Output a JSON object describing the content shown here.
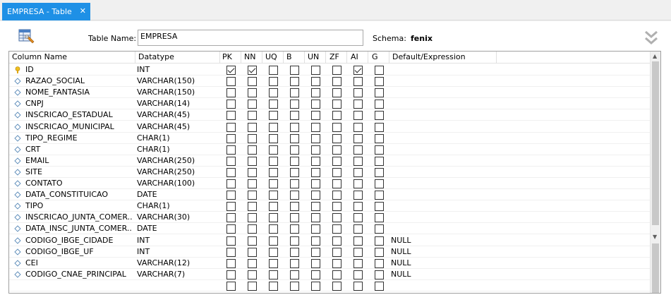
{
  "tab": {
    "label": "EMPRESA - Table",
    "close": "✕",
    "active_color": "#1e90e6"
  },
  "header": {
    "table_name_label": "Table Name:",
    "table_name_value": "EMPRESA",
    "schema_label": "Schema:",
    "schema_value": "fenix"
  },
  "columns_header": [
    "Column Name",
    "Datatype",
    "PK",
    "NN",
    "UQ",
    "B",
    "UN",
    "ZF",
    "AI",
    "G",
    "Default/Expression"
  ],
  "rows": [
    {
      "name": "ID",
      "type": "INT",
      "pk": true,
      "nn": true,
      "uq": false,
      "b": false,
      "un": false,
      "zf": false,
      "ai": true,
      "g": false,
      "def": "",
      "icon": "key-icon"
    },
    {
      "name": "RAZAO_SOCIAL",
      "type": "VARCHAR(150)",
      "pk": false,
      "nn": false,
      "uq": false,
      "b": false,
      "un": false,
      "zf": false,
      "ai": false,
      "g": false,
      "def": "",
      "icon": "diamond-icon"
    },
    {
      "name": "NOME_FANTASIA",
      "type": "VARCHAR(150)",
      "pk": false,
      "nn": false,
      "uq": false,
      "b": false,
      "un": false,
      "zf": false,
      "ai": false,
      "g": false,
      "def": "",
      "icon": "diamond-icon"
    },
    {
      "name": "CNPJ",
      "type": "VARCHAR(14)",
      "pk": false,
      "nn": false,
      "uq": false,
      "b": false,
      "un": false,
      "zf": false,
      "ai": false,
      "g": false,
      "def": "",
      "icon": "diamond-icon"
    },
    {
      "name": "INSCRICAO_ESTADUAL",
      "type": "VARCHAR(45)",
      "pk": false,
      "nn": false,
      "uq": false,
      "b": false,
      "un": false,
      "zf": false,
      "ai": false,
      "g": false,
      "def": "",
      "icon": "diamond-icon"
    },
    {
      "name": "INSCRICAO_MUNICIPAL",
      "type": "VARCHAR(45)",
      "pk": false,
      "nn": false,
      "uq": false,
      "b": false,
      "un": false,
      "zf": false,
      "ai": false,
      "g": false,
      "def": "",
      "icon": "diamond-icon"
    },
    {
      "name": "TIPO_REGIME",
      "type": "CHAR(1)",
      "pk": false,
      "nn": false,
      "uq": false,
      "b": false,
      "un": false,
      "zf": false,
      "ai": false,
      "g": false,
      "def": "",
      "icon": "diamond-icon"
    },
    {
      "name": "CRT",
      "type": "CHAR(1)",
      "pk": false,
      "nn": false,
      "uq": false,
      "b": false,
      "un": false,
      "zf": false,
      "ai": false,
      "g": false,
      "def": "",
      "icon": "diamond-icon"
    },
    {
      "name": "EMAIL",
      "type": "VARCHAR(250)",
      "pk": false,
      "nn": false,
      "uq": false,
      "b": false,
      "un": false,
      "zf": false,
      "ai": false,
      "g": false,
      "def": "",
      "icon": "diamond-icon"
    },
    {
      "name": "SITE",
      "type": "VARCHAR(250)",
      "pk": false,
      "nn": false,
      "uq": false,
      "b": false,
      "un": false,
      "zf": false,
      "ai": false,
      "g": false,
      "def": "",
      "icon": "diamond-icon"
    },
    {
      "name": "CONTATO",
      "type": "VARCHAR(100)",
      "pk": false,
      "nn": false,
      "uq": false,
      "b": false,
      "un": false,
      "zf": false,
      "ai": false,
      "g": false,
      "def": "",
      "icon": "diamond-icon"
    },
    {
      "name": "DATA_CONSTITUICAO",
      "type": "DATE",
      "pk": false,
      "nn": false,
      "uq": false,
      "b": false,
      "un": false,
      "zf": false,
      "ai": false,
      "g": false,
      "def": "",
      "icon": "diamond-icon"
    },
    {
      "name": "TIPO",
      "type": "CHAR(1)",
      "pk": false,
      "nn": false,
      "uq": false,
      "b": false,
      "un": false,
      "zf": false,
      "ai": false,
      "g": false,
      "def": "",
      "icon": "diamond-icon"
    },
    {
      "name": "INSCRICAO_JUNTA_COMER...",
      "type": "VARCHAR(30)",
      "pk": false,
      "nn": false,
      "uq": false,
      "b": false,
      "un": false,
      "zf": false,
      "ai": false,
      "g": false,
      "def": "",
      "icon": "diamond-icon"
    },
    {
      "name": "DATA_INSC_JUNTA_COMER...",
      "type": "DATE",
      "pk": false,
      "nn": false,
      "uq": false,
      "b": false,
      "un": false,
      "zf": false,
      "ai": false,
      "g": false,
      "def": "",
      "icon": "diamond-icon"
    },
    {
      "name": "CODIGO_IBGE_CIDADE",
      "type": "INT",
      "pk": false,
      "nn": false,
      "uq": false,
      "b": false,
      "un": false,
      "zf": false,
      "ai": false,
      "g": false,
      "def": "NULL",
      "icon": "diamond-icon"
    },
    {
      "name": "CODIGO_IBGE_UF",
      "type": "INT",
      "pk": false,
      "nn": false,
      "uq": false,
      "b": false,
      "un": false,
      "zf": false,
      "ai": false,
      "g": false,
      "def": "NULL",
      "icon": "diamond-icon"
    },
    {
      "name": "CEI",
      "type": "VARCHAR(12)",
      "pk": false,
      "nn": false,
      "uq": false,
      "b": false,
      "un": false,
      "zf": false,
      "ai": false,
      "g": false,
      "def": "NULL",
      "icon": "diamond-icon"
    },
    {
      "name": "CODIGO_CNAE_PRINCIPAL",
      "type": "VARCHAR(7)",
      "pk": false,
      "nn": false,
      "uq": false,
      "b": false,
      "un": false,
      "zf": false,
      "ai": false,
      "g": false,
      "def": "NULL",
      "icon": "diamond-icon"
    },
    {
      "name": "",
      "type": "",
      "pk": false,
      "nn": false,
      "uq": false,
      "b": false,
      "un": false,
      "zf": false,
      "ai": false,
      "g": false,
      "def": "",
      "icon": ""
    }
  ],
  "scrollbar": {
    "up": "▲",
    "down": "▼"
  }
}
